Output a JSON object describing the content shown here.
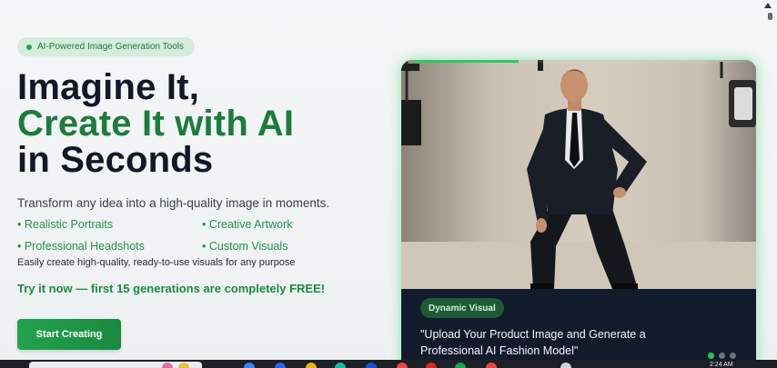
{
  "badge": {
    "label": "AI-Powered Image Generation Tools"
  },
  "hero": {
    "line1": "Imagine It,",
    "line2": "Create It with AI",
    "line3": "in Seconds"
  },
  "subtitle": "Transform any idea into a high-quality image in moments.",
  "features": [
    "• Realistic Portraits",
    "• Creative Artwork",
    "• Professional Headshots",
    "• Custom Visuals"
  ],
  "tagline": "Easily create high-quality, ready-to-use visuals for any purpose",
  "promo": "Try it now — first 15 generations are completely FREE!",
  "cta": {
    "label": "Start Creating"
  },
  "showcase": {
    "chip": "Dynamic Visual",
    "quote": "\"Upload Your Product Image and Generate a Professional AI Fashion Model\"",
    "slide_count": 3,
    "active_slide": 1,
    "progress_fraction": 0.3
  },
  "taskbar": {
    "clock": "2:24 AM"
  },
  "colors": {
    "accent": "#1c7c3d",
    "accent_light": "#22a84d",
    "card_bg": "#121b2c",
    "glow": "#3cd26e"
  }
}
